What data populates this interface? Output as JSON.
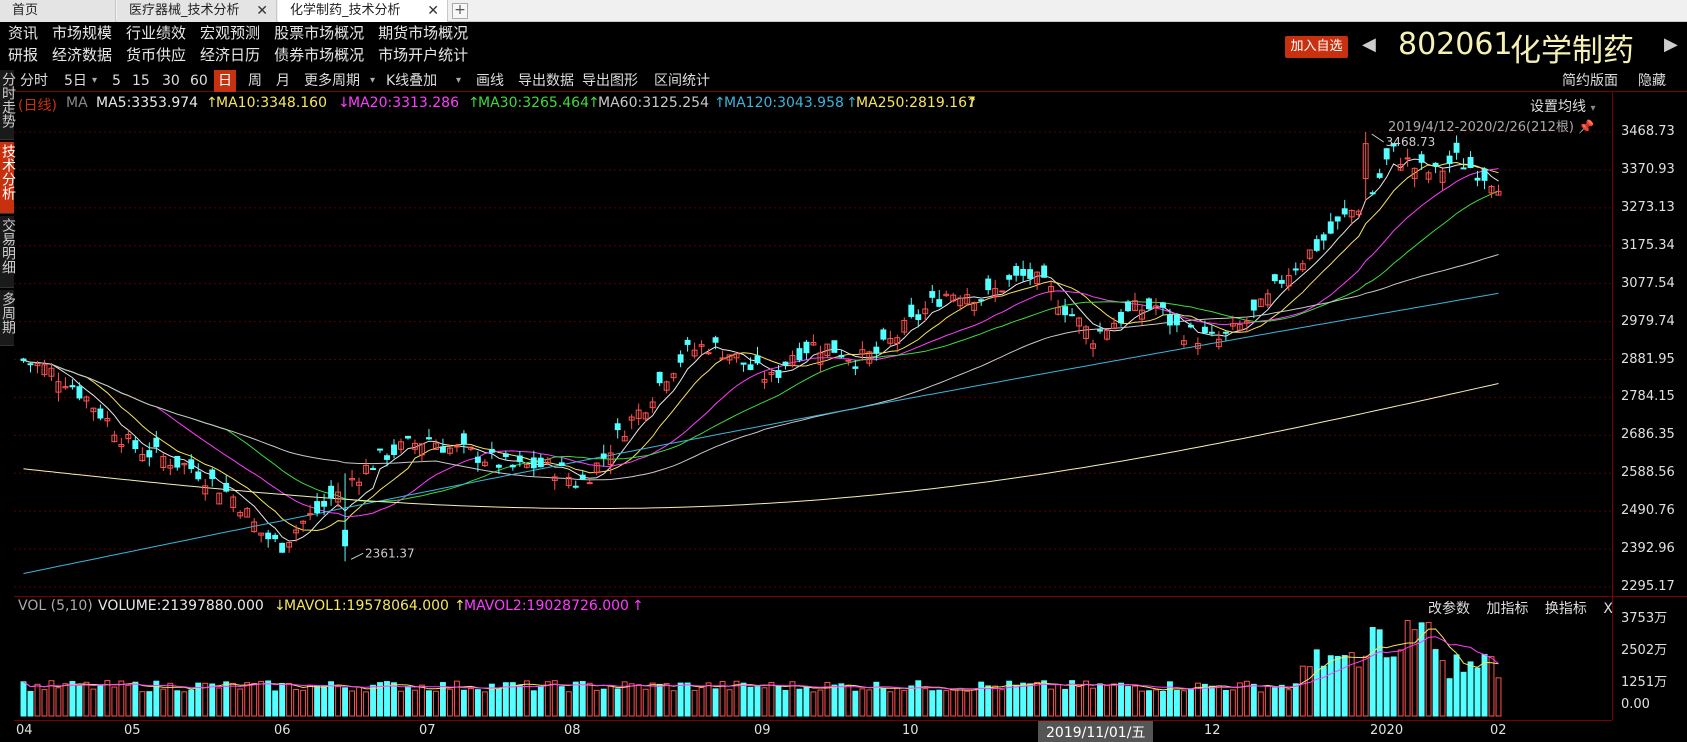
{
  "tabs": [
    {
      "label": "首页"
    },
    {
      "label": "医疗器械_技术分析"
    },
    {
      "label": "化学制药_技术分析"
    }
  ],
  "menu_row1": [
    "资讯",
    "市场规模",
    "行业绩效",
    "宏观预测",
    "股票市场概况",
    "期货市场概况"
  ],
  "menu_row2": [
    "研报",
    "经济数据",
    "货币供应",
    "经济日历",
    "债券市场概况",
    "市场开户统计"
  ],
  "header": {
    "add_favorite": "加入自选",
    "stock_code": "802061",
    "stock_name": "化学制药"
  },
  "left_tabs": [
    "分时走势",
    "技术分析",
    "交易明细",
    "多周期"
  ],
  "period_toolbar": {
    "items": [
      "分时",
      "5日",
      "5",
      "15",
      "30",
      "60",
      "日",
      "周",
      "月",
      "更多周期",
      "K线叠加",
      "画线",
      "导出数据",
      "导出图形",
      "区间统计"
    ],
    "active": "日",
    "right_items": [
      "简约版面",
      "隐藏"
    ]
  },
  "ma_legend": {
    "kind": "(日线)",
    "ma_label": "MA",
    "ma5": "MA5:3353.974",
    "ma10": "MA10:3348.160",
    "ma20": "MA20:3313.286",
    "ma30": "MA30:3265.464",
    "ma60": "MA60:3125.254",
    "ma120": "MA120:3043.958",
    "ma250": "MA250:2819.167",
    "arrows": [
      "↑",
      "↓",
      "↑",
      "↑",
      "↑",
      "↑",
      "↑"
    ]
  },
  "set_ma_label": "设置均线",
  "date_range": "2019/4/12-2020/2/26(212根)",
  "price_axis": [
    "3468.73",
    "3370.93",
    "3273.13",
    "3175.34",
    "3077.54",
    "2979.74",
    "2881.95",
    "2784.15",
    "2686.35",
    "2588.56",
    "2490.76",
    "2392.96",
    "2295.17"
  ],
  "annotations": {
    "high": "3468.73",
    "low": "2361.37"
  },
  "vol_legend": {
    "label": "VOL (5,10)",
    "volume": "VOLUME:21397880.000",
    "mavol1": "MAVOL1:19578064.000",
    "mavol2": "MAVOL2:19028726.000",
    "arrows": [
      "↓",
      "↑",
      "↑"
    ]
  },
  "vol_tools": [
    "改参数",
    "加指标",
    "换指标",
    "X"
  ],
  "vol_axis": [
    "3753万",
    "2502万",
    "1251万",
    "0.00"
  ],
  "x_axis": [
    "04",
    "05",
    "06",
    "07",
    "08",
    "09",
    "10",
    "12",
    "2020",
    "02"
  ],
  "cursor_date": "2019/11/01/五",
  "colors": {
    "up": "#ff5050",
    "down": "#54ffff",
    "ma5": "#e8e8e8",
    "ma10": "#f5e65a",
    "ma20": "#ff3cff",
    "ma30": "#3cdc3c",
    "ma60": "#c8c8c8",
    "ma120": "#3cb4dc",
    "ma250": "#f5f0b4"
  },
  "chart_data": {
    "type": "candlestick",
    "x_range": [
      "2019/4/12",
      "2020/2/26"
    ],
    "ylim": [
      2295.17,
      3468.73
    ],
    "bar_count": 212,
    "high": 3468.73,
    "low": 2361.37,
    "ma_last": {
      "MA5": 3353.974,
      "MA10": 3348.16,
      "MA20": 3313.286,
      "MA30": 3265.464,
      "MA60": 3125.254,
      "MA120": 3043.958,
      "MA250": 2819.167
    },
    "close_path": [
      2880,
      2860,
      2830,
      2780,
      2720,
      2660,
      2640,
      2620,
      2600,
      2560,
      2520,
      2440,
      2400,
      2460,
      2500,
      2560,
      2600,
      2640,
      2660,
      2680,
      2650,
      2640,
      2620,
      2600,
      2610,
      2600,
      2560,
      2620,
      2700,
      2760,
      2840,
      2900,
      2920,
      2900,
      2860,
      2830,
      2900,
      2920,
      2910,
      2880,
      2900,
      2950,
      3000,
      3050,
      3060,
      3040,
      3080,
      3100,
      3060,
      3000,
      2940,
      2980,
      3010,
      3020,
      2960,
      2940,
      2930,
      2970,
      3020,
      3100,
      3150,
      3200,
      3260,
      3300,
      3420,
      3380,
      3360,
      3400,
      3370,
      3340
    ],
    "volume_unit": "万"
  }
}
